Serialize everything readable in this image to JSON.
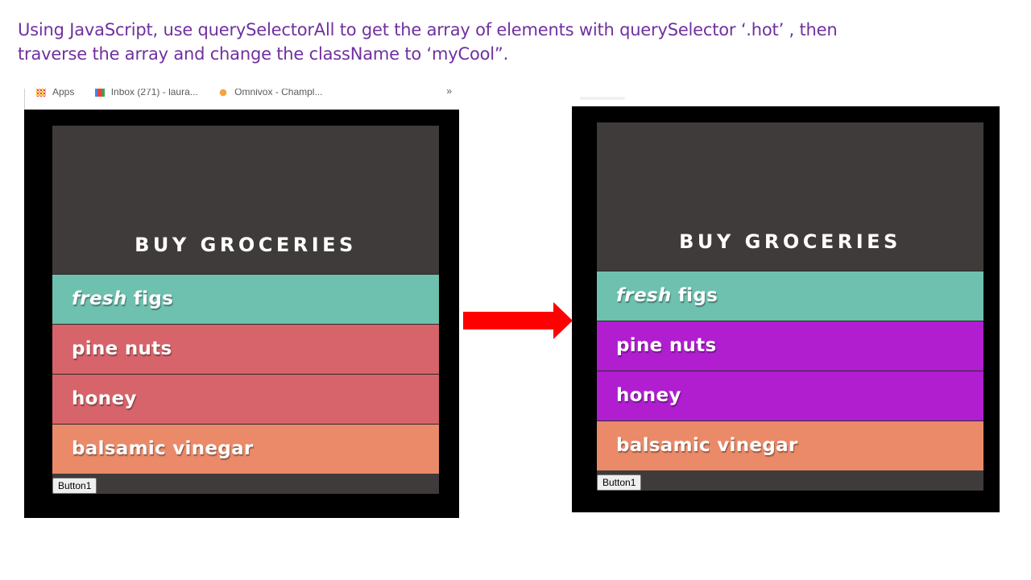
{
  "instructions": {
    "line1": "Using JavaScript, use querySelectorAll to get the array of elements with querySelector ‘.hot’ , then",
    "line2": "traverse the array and change the className to ‘myCool”."
  },
  "bookmarks_bar": {
    "items": [
      {
        "label": "Apps",
        "icon": "apps-icon"
      },
      {
        "label": "Inbox (271) - laura...",
        "icon": "gmail-icon"
      },
      {
        "label": "Omnivox - Champl...",
        "icon": "omnivox-icon"
      }
    ],
    "more": "»"
  },
  "before": {
    "title": "BUY GROCERIES",
    "items": [
      {
        "prefix": "fresh",
        "label": " figs",
        "class": "cool",
        "color": "#6dc1ae"
      },
      {
        "prefix": "",
        "label": "pine nuts",
        "class": "hot",
        "color": "#d6646a"
      },
      {
        "prefix": "",
        "label": "honey",
        "class": "hot",
        "color": "#d6646a"
      },
      {
        "prefix": "",
        "label": "balsamic vinegar",
        "class": "",
        "color": "#ea8a69"
      }
    ],
    "button_label": "Button1"
  },
  "after": {
    "title": "BUY GROCERIES",
    "items": [
      {
        "prefix": "fresh",
        "label": " figs",
        "class": "cool",
        "color": "#6dc1ae"
      },
      {
        "prefix": "",
        "label": "pine nuts",
        "class": "myCool",
        "color": "#b01ed0"
      },
      {
        "prefix": "",
        "label": "honey",
        "class": "myCool",
        "color": "#b01ed0"
      },
      {
        "prefix": "",
        "label": "balsamic vinegar",
        "class": "",
        "color": "#ea8a69"
      }
    ],
    "button_label": "Button1"
  },
  "colors": {
    "instruction_text": "#7030a0",
    "app_background": "#3f3b3a",
    "arrow": "#ff0000"
  }
}
